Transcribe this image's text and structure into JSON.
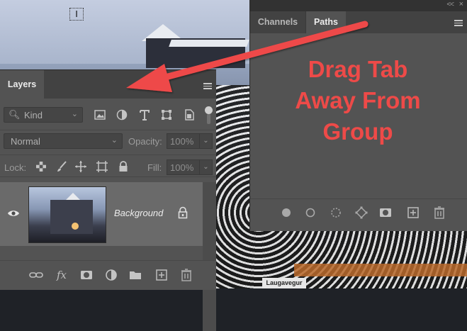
{
  "paths_panel": {
    "tabs": [
      {
        "label": "Channels",
        "active": false
      },
      {
        "label": "Paths",
        "active": true
      }
    ],
    "collapse_icon": "double-chevron-left-icon",
    "close_icon": "close-icon",
    "menu_icon": "hamburger-menu-icon",
    "footer_buttons": [
      "fill-path-icon",
      "stroke-path-icon",
      "load-selection-icon",
      "make-work-path-icon",
      "add-mask-icon",
      "new-path-icon",
      "delete-path-icon"
    ]
  },
  "layers_panel": {
    "tab_label": "Layers",
    "menu_icon": "hamburger-menu-icon",
    "filter": {
      "kind_label": "Kind",
      "icons": [
        "pixel-layer-filter-icon",
        "adjustment-layer-filter-icon",
        "type-layer-filter-icon",
        "shape-layer-filter-icon",
        "smart-object-filter-icon"
      ]
    },
    "blend_mode": "Normal",
    "opacity_label": "Opacity:",
    "opacity_value": "100%",
    "lock_label": "Lock:",
    "lock_icons": [
      "lock-transparent-icon",
      "lock-image-icon",
      "lock-position-icon",
      "artboard-lock-icon",
      "lock-all-icon"
    ],
    "fill_label": "Fill:",
    "fill_value": "100%",
    "layers": [
      {
        "name": "Background",
        "visible": true,
        "locked": true
      }
    ],
    "footer_buttons": [
      "link-layers-icon",
      "fx-icon",
      "add-mask-icon",
      "adjustment-layer-icon",
      "group-folder-icon",
      "new-layer-icon",
      "delete-layer-icon"
    ],
    "fx_label": "fx"
  },
  "annotation": {
    "lines": [
      "Drag Tab",
      "Away From",
      "Group"
    ],
    "color": "#ee4a48"
  },
  "canvas": {
    "street_sign": "Laugavegur"
  },
  "colors": {
    "panel_bg": "#535353",
    "tab_bar_bg": "#424242",
    "selected_layer_bg": "#6a6a6a"
  }
}
